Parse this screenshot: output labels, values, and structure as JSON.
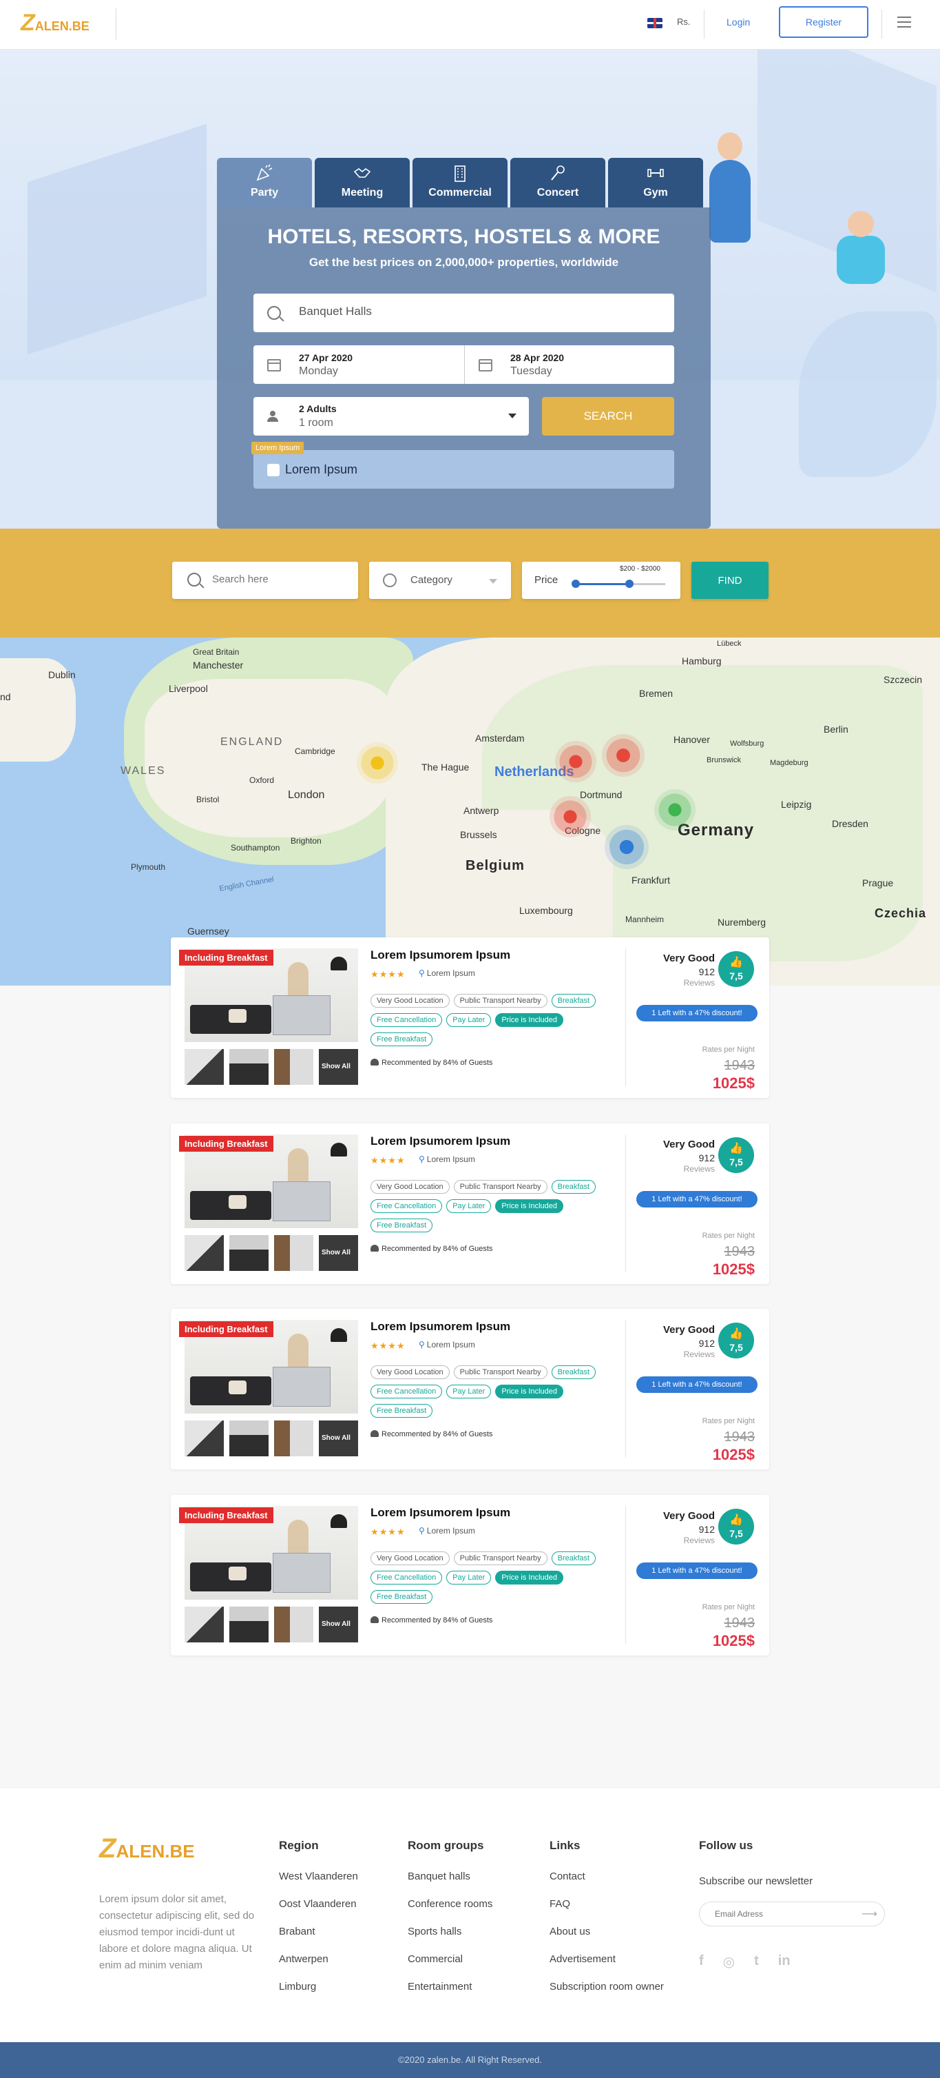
{
  "header": {
    "logo_text": "ALEN.BE",
    "logo_z": "Z",
    "currency": "Rs.",
    "login": "Login",
    "register": "Register"
  },
  "hero": {
    "tabs": [
      {
        "label": "Party",
        "icon": "party-icon"
      },
      {
        "label": "Meeting",
        "icon": "handshake-icon"
      },
      {
        "label": "Commercial",
        "icon": "building-icon"
      },
      {
        "label": "Concert",
        "icon": "microphone-icon"
      },
      {
        "label": "Gym",
        "icon": "dumbbell-icon"
      }
    ],
    "title": "HOTELS, RESORTS, HOSTELS & MORE",
    "subtitle": "Get the best prices on 2,000,000+ properties, worldwide",
    "destination_value": "Banquet Halls",
    "checkin_date": "27 Apr 2020",
    "checkin_day": "Monday",
    "checkout_date": "28 Apr 2020",
    "checkout_day": "Tuesday",
    "guests": "2 Adults",
    "rooms": "1 room",
    "search_button": "SEARCH",
    "checkbox_tag": "Lorem Ipsum",
    "checkbox_label": "Lorem Ipsum"
  },
  "filter": {
    "search_placeholder": "Search here",
    "category": "Category",
    "price_label": "Price",
    "price_range": "$200 - $2000",
    "price_range_fraction": [
      0.0,
      0.6
    ],
    "find_button": "FIND"
  },
  "map": {
    "places": [
      "Great Britain",
      "Manchester",
      "Liverpool",
      "Dublin",
      "ENGLAND",
      "WALES",
      "Cambridge",
      "Oxford",
      "London",
      "Bristol",
      "Southampton",
      "Brighton",
      "Plymouth",
      "English Channel",
      "Guernsey",
      "Amsterdam",
      "The Hague",
      "Netherlands",
      "Antwerp",
      "Brussels",
      "Belgium",
      "Dortmund",
      "Cologne",
      "Luxembourg",
      "Frankfurt",
      "Mannheim",
      "Nuremberg",
      "Hamburg",
      "Bremen",
      "Lübeck",
      "Szczecin",
      "Berlin",
      "Hanover",
      "Wolfsburg",
      "Brunswick",
      "Magdeburg",
      "Leipzig",
      "Dresden",
      "Germany",
      "Prague",
      "Czechia",
      "nd"
    ],
    "marker_colors": [
      "#f2c21b",
      "#e5483b",
      "#e5483b",
      "#e5483b",
      "#2f7bd6",
      "#3fb550"
    ]
  },
  "listings": [
    {
      "badge": "Including Breakfast",
      "title": "Lorem Ipsumorem Ipsum",
      "stars": "★★★★",
      "location": "Lorem Ipsum",
      "tags_row1": [
        "Very Good Location",
        "Public Transport Nearby",
        "Breakfast"
      ],
      "tags_row2": [
        "Free Cancellation",
        "Pay Later",
        "Price is Included"
      ],
      "tags_row3": [
        "Free Breakfast"
      ],
      "recommend": "Recommented by 84% of Guests",
      "show_all": "Show All",
      "rating_label": "Very Good",
      "reviews_count": "912",
      "reviews_label": "Reviews",
      "score": "7,5",
      "discount": "1 Left with a 47% discount!",
      "rate_label": "Rates per Night",
      "old_price": "1943",
      "new_price": "1025$"
    },
    {
      "badge": "Including Breakfast",
      "title": "Lorem Ipsumorem Ipsum",
      "stars": "★★★★",
      "location": "Lorem Ipsum",
      "tags_row1": [
        "Very Good Location",
        "Public Transport Nearby",
        "Breakfast"
      ],
      "tags_row2": [
        "Free Cancellation",
        "Pay Later",
        "Price is Included"
      ],
      "tags_row3": [
        "Free Breakfast"
      ],
      "recommend": "Recommented by 84% of Guests",
      "show_all": "Show All",
      "rating_label": "Very Good",
      "reviews_count": "912",
      "reviews_label": "Reviews",
      "score": "7,5",
      "discount": "1 Left with a 47% discount!",
      "rate_label": "Rates per Night",
      "old_price": "1943",
      "new_price": "1025$"
    },
    {
      "badge": "Including Breakfast",
      "title": "Lorem Ipsumorem Ipsum",
      "stars": "★★★★",
      "location": "Lorem Ipsum",
      "tags_row1": [
        "Very Good Location",
        "Public Transport Nearby",
        "Breakfast"
      ],
      "tags_row2": [
        "Free Cancellation",
        "Pay Later",
        "Price is Included"
      ],
      "tags_row3": [
        "Free Breakfast"
      ],
      "recommend": "Recommented by 84% of Guests",
      "show_all": "Show All",
      "rating_label": "Very Good",
      "reviews_count": "912",
      "reviews_label": "Reviews",
      "score": "7,5",
      "discount": "1 Left with a 47% discount!",
      "rate_label": "Rates per Night",
      "old_price": "1943",
      "new_price": "1025$"
    },
    {
      "badge": "Including Breakfast",
      "title": "Lorem Ipsumorem Ipsum",
      "stars": "★★★★",
      "location": "Lorem Ipsum",
      "tags_row1": [
        "Very Good Location",
        "Public Transport Nearby",
        "Breakfast"
      ],
      "tags_row2": [
        "Free Cancellation",
        "Pay Later",
        "Price is Included"
      ],
      "tags_row3": [
        "Free Breakfast"
      ],
      "recommend": "Recommented by 84% of Guests",
      "show_all": "Show All",
      "rating_label": "Very Good",
      "reviews_count": "912",
      "reviews_label": "Reviews",
      "score": "7,5",
      "discount": "1 Left with a 47% discount!",
      "rate_label": "Rates per Night",
      "old_price": "1943",
      "new_price": "1025$"
    }
  ],
  "footer": {
    "logo_z": "Z",
    "logo_text": "ALEN.BE",
    "about": "Lorem ipsum dolor sit amet, consectetur adipiscing elit, sed do eiusmod tempor incidi-dunt ut labore et dolore magna aliqua. Ut enim ad minim veniam",
    "region_title": "Region",
    "region": [
      "West Vlaanderen",
      "Oost Vlaanderen",
      "Brabant",
      "Antwerpen",
      "Limburg"
    ],
    "rooms_title": "Room groups",
    "rooms": [
      "Banquet halls",
      "Conference rooms",
      "Sports halls",
      "Commercial",
      "Entertainment"
    ],
    "links_title": "Links",
    "links": [
      "Contact",
      "FAQ",
      "About us",
      "Advertisement",
      "Subscription room owner"
    ],
    "follow_title": "Follow us",
    "newsletter": "Subscribe our newsletter",
    "email_placeholder": "Email Adress",
    "social": [
      "f",
      "◎",
      "t",
      "in"
    ],
    "copyright": "©2020 zalen.be. All Right Reserved."
  },
  "colors": {
    "accent_yellow": "#e4b54c",
    "accent_teal": "#17a89a",
    "accent_blue": "#2f7bd6",
    "price_red": "#e0374a",
    "footer_bar": "#3e6595"
  }
}
